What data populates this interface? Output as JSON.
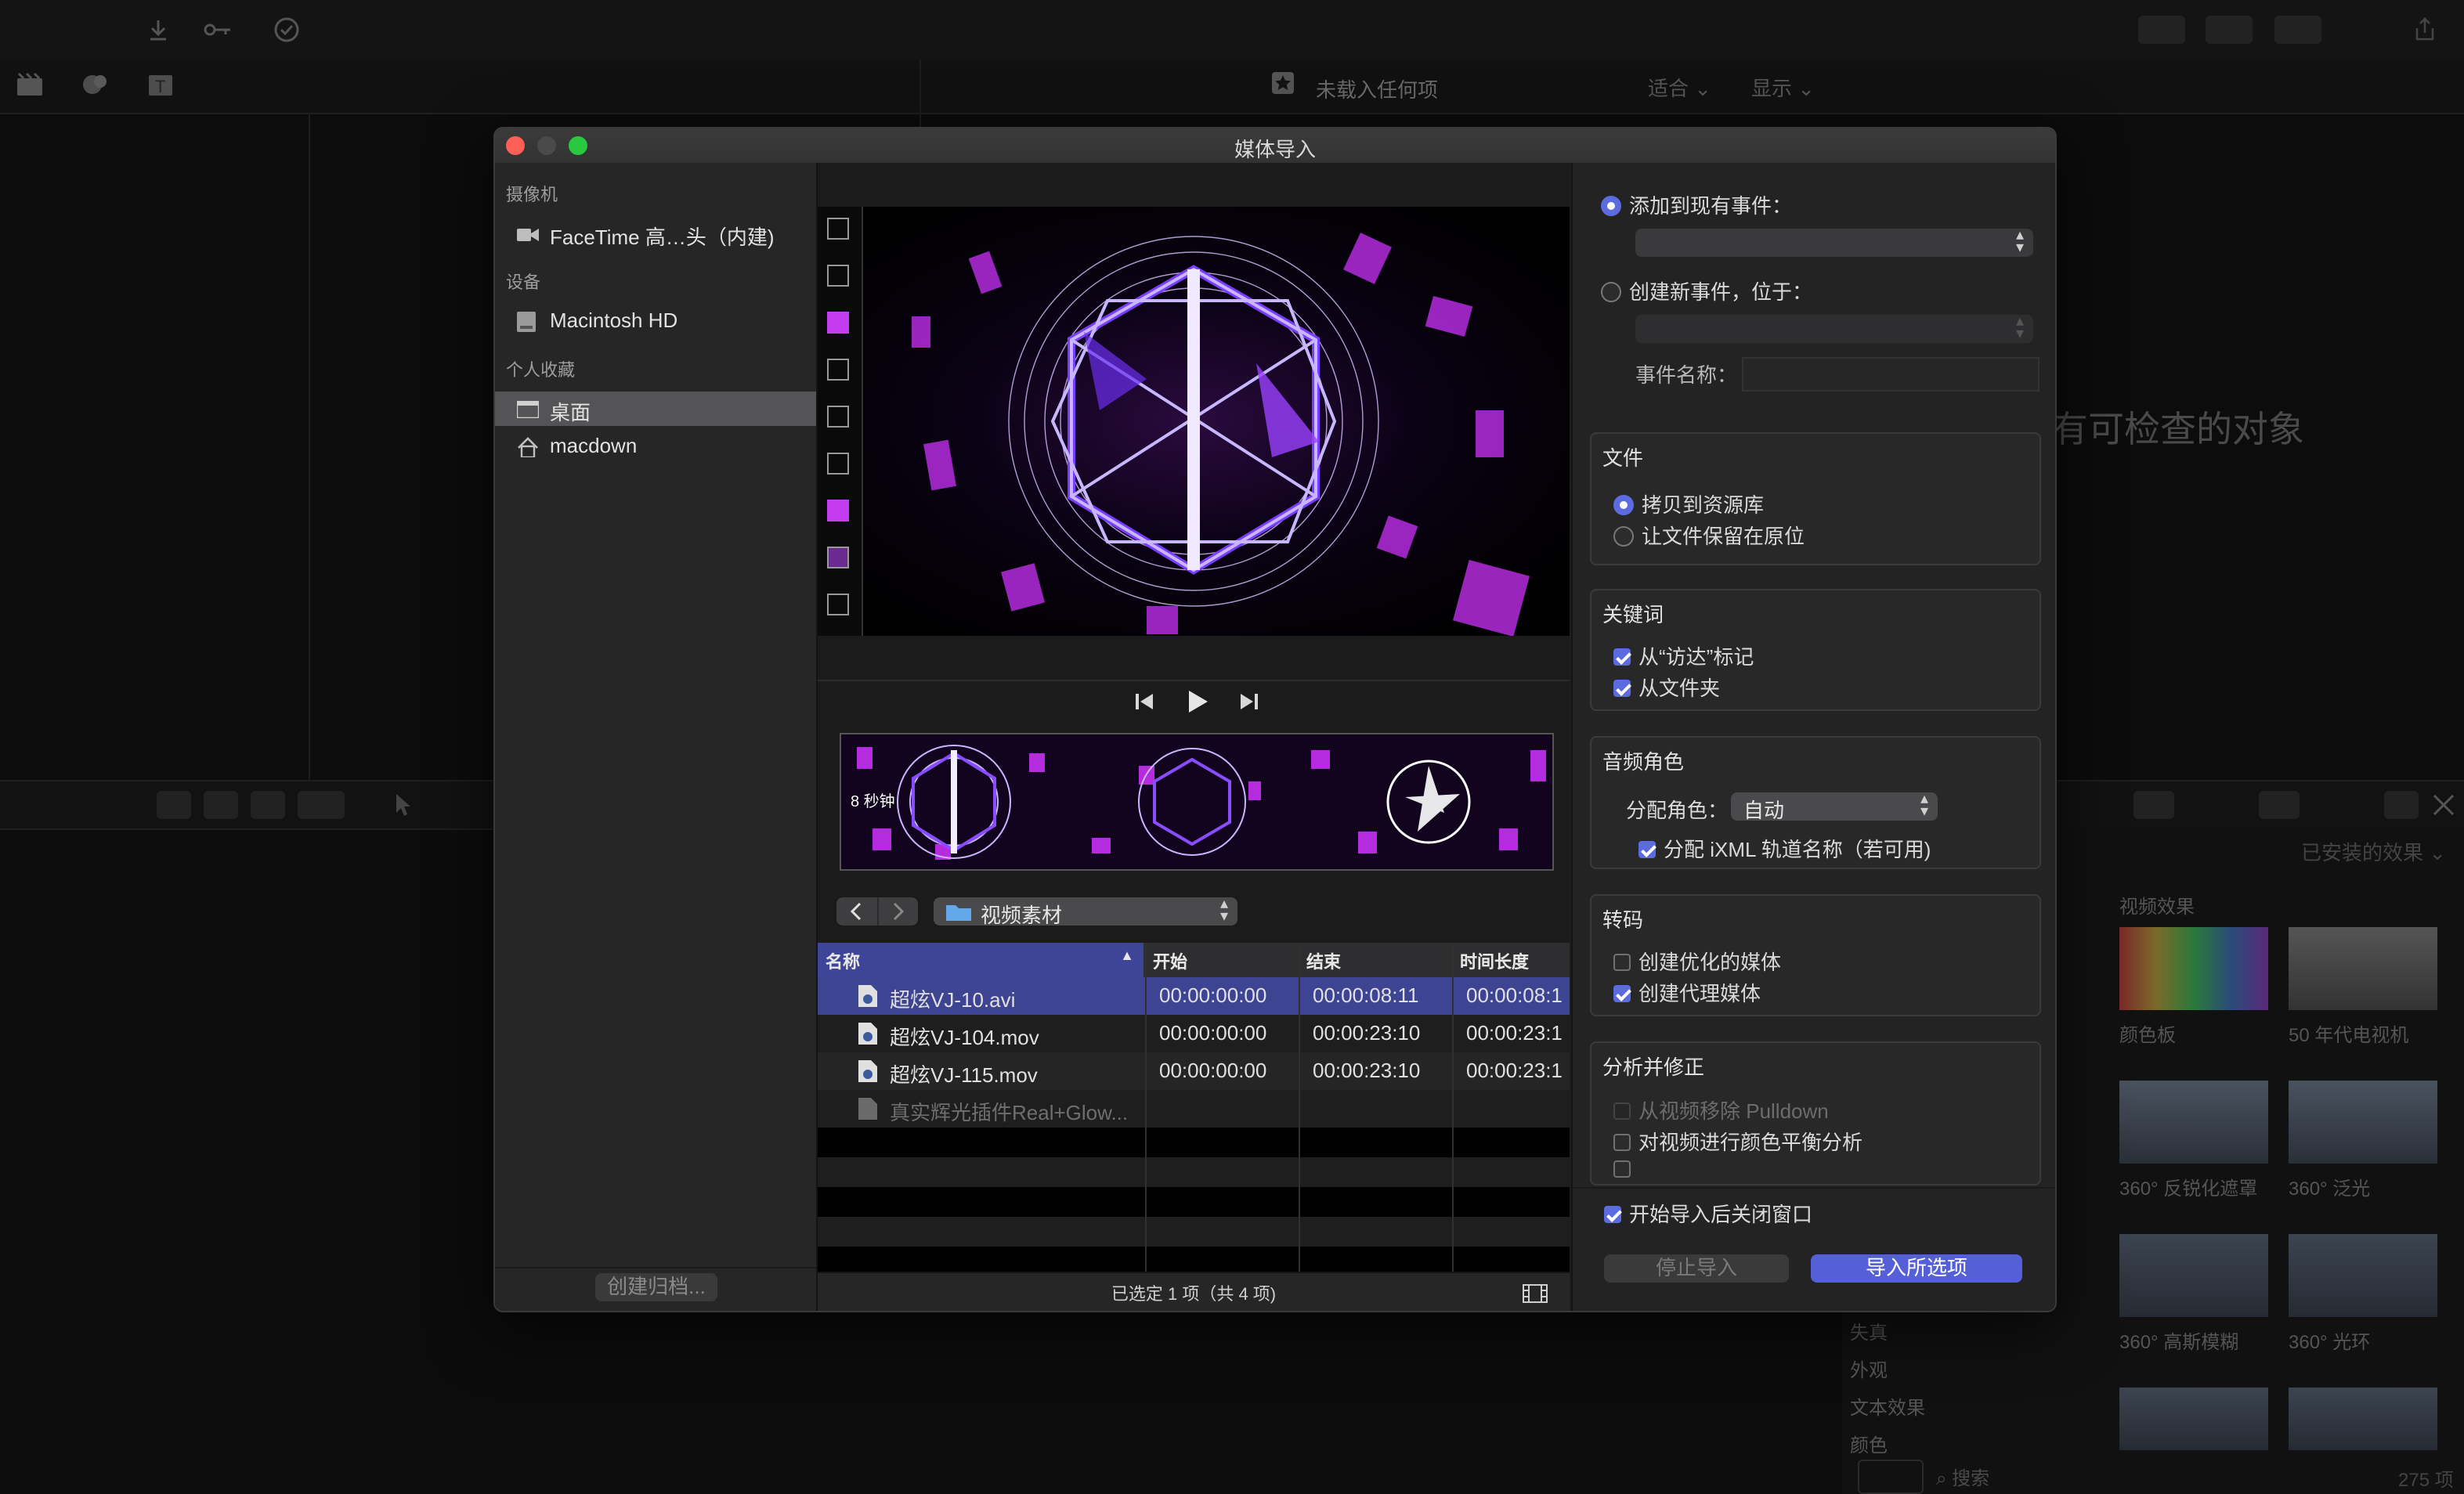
{
  "background": {
    "viewer_title": "未载入任何项",
    "fit_label": "适合",
    "display_label": "显示",
    "inspector_empty": "有可检查的对象",
    "effects_dropdown": "已安装的效果",
    "effects_category": "视频效果",
    "effects": [
      {
        "label": "颜色板"
      },
      {
        "label": "50 年代电视机"
      },
      {
        "label": "360° 反锐化遮罩"
      },
      {
        "label": "360° 泛光"
      },
      {
        "label": "360° 高斯模糊"
      },
      {
        "label": "360° 光环"
      }
    ],
    "effects_sidebar": [
      "失真",
      "外观",
      "文本效果",
      "颜色"
    ],
    "search_placeholder": "搜索",
    "effects_count": "275 项"
  },
  "dialog": {
    "title": "媒体导入",
    "sidebar": {
      "sections": [
        {
          "header": "摄像机",
          "items": [
            {
              "label": "FaceTime 高…头（内建)",
              "icon": "camera-icon"
            }
          ]
        },
        {
          "header": "设备",
          "items": [
            {
              "label": "Macintosh HD",
              "icon": "hard-drive-icon"
            }
          ]
        },
        {
          "header": "个人收藏",
          "items": [
            {
              "label": "桌面",
              "icon": "desktop-icon",
              "selected": true
            },
            {
              "label": "macdown",
              "icon": "home-icon"
            }
          ]
        }
      ],
      "create_archive": "创建归档..."
    },
    "filmstrip_label": "8 秒钟",
    "folder_name": "视频素材",
    "table": {
      "headers": [
        "名称",
        "开始",
        "结束",
        "时间长度"
      ],
      "rows": [
        {
          "name": "超炫VJ-10.avi",
          "start": "00:00:00:00",
          "end": "00:00:08:11",
          "duration": "00:00:08:1",
          "selected": true
        },
        {
          "name": "超炫VJ-104.mov",
          "start": "00:00:00:00",
          "end": "00:00:23:10",
          "duration": "00:00:23:1"
        },
        {
          "name": "超炫VJ-115.mov",
          "start": "00:00:00:00",
          "end": "00:00:23:10",
          "duration": "00:00:23:1"
        },
        {
          "name": "真实辉光插件Real+Glow...",
          "start": "",
          "end": "",
          "duration": "",
          "disabled": true
        }
      ]
    },
    "status": "已选定 1 项（共 4 项)",
    "options": {
      "add_existing": "添加到现有事件：",
      "create_new": "创建新事件，位于：",
      "event_name": "事件名称：",
      "files_title": "文件",
      "copy_to_library": "拷贝到资源库",
      "leave_in_place": "让文件保留在原位",
      "keywords_title": "关键词",
      "from_finder_tags": "从“访达”标记",
      "from_folders": "从文件夹",
      "audio_roles_title": "音频角色",
      "assign_roles": "分配角色：",
      "assign_roles_value": "自动",
      "assign_ixml": "分配 iXML 轨道名称（若可用)",
      "transcode_title": "转码",
      "create_optimized": "创建优化的媒体",
      "create_proxy": "创建代理媒体",
      "analyze_title": "分析并修正",
      "remove_pulldown": "从视频移除 Pulldown",
      "color_balance": "对视频进行颜色平衡分析",
      "close_after_import": "开始导入后关闭窗口",
      "stop_import": "停止导入",
      "import_selected": "导入所选项"
    }
  },
  "colors": {
    "accent": "#5c6be0",
    "selection": "#3d4592",
    "magenta": "#c43cf0"
  }
}
